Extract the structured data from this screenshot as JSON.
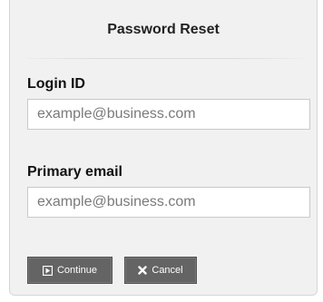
{
  "dialog": {
    "title": "Password Reset"
  },
  "login": {
    "label": "Login ID",
    "placeholder": "example@business.com",
    "value": ""
  },
  "email": {
    "label": "Primary email",
    "placeholder": "example@business.com",
    "value": ""
  },
  "actions": {
    "continue_label": "Continue",
    "continue_icon": "play-box-icon",
    "cancel_label": "Cancel",
    "cancel_icon": "x-icon"
  },
  "colors": {
    "panel_bg": "#f1f1f1",
    "button_bg": "#646464",
    "button_text": "#ffffff"
  }
}
